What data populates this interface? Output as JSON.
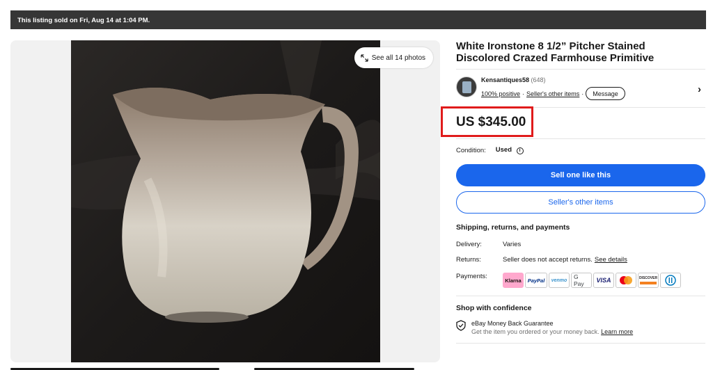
{
  "banner": {
    "text": "This listing sold on Fri, Aug 14 at 1:04 PM."
  },
  "gallery": {
    "see_all_label": "See all 14 photos"
  },
  "listing": {
    "title": "White Ironstone 8 1/2” Pitcher Stained Discolored Crazed Farmhouse Primitive",
    "price": "US $345.00"
  },
  "seller": {
    "name": "Kensantiques58",
    "feedback_count": "(648)",
    "positive": "100% positive",
    "separator": "·",
    "other_items_link": "Seller's other items",
    "message_button": "Message"
  },
  "condition": {
    "label": "Condition:",
    "value": "Used",
    "info_glyph": "i"
  },
  "buttons": {
    "sell_one": "Sell one like this",
    "sellers_other_items": "Seller's other items"
  },
  "shipping": {
    "heading": "Shipping, returns, and payments",
    "delivery_label": "Delivery:",
    "delivery_value": "Varies",
    "returns_label": "Returns:",
    "returns_value": "Seller does not accept returns.",
    "returns_link": "See details",
    "payments_label": "Payments:",
    "payment_methods": {
      "klarna": "Klarna",
      "paypal": "PayPal",
      "venmo": "venmo",
      "gpay": "G Pay",
      "visa": "VISA",
      "discover": "DISCOVER"
    }
  },
  "confidence": {
    "heading": "Shop with confidence",
    "guarantee_title": "eBay Money Back Guarantee",
    "guarantee_text": "Get the item you ordered or your money back.",
    "learn_more": "Learn more"
  },
  "colors": {
    "accent_blue": "#1a66ec",
    "banner_bg": "#363636",
    "highlight_red": "#e01b1b"
  }
}
